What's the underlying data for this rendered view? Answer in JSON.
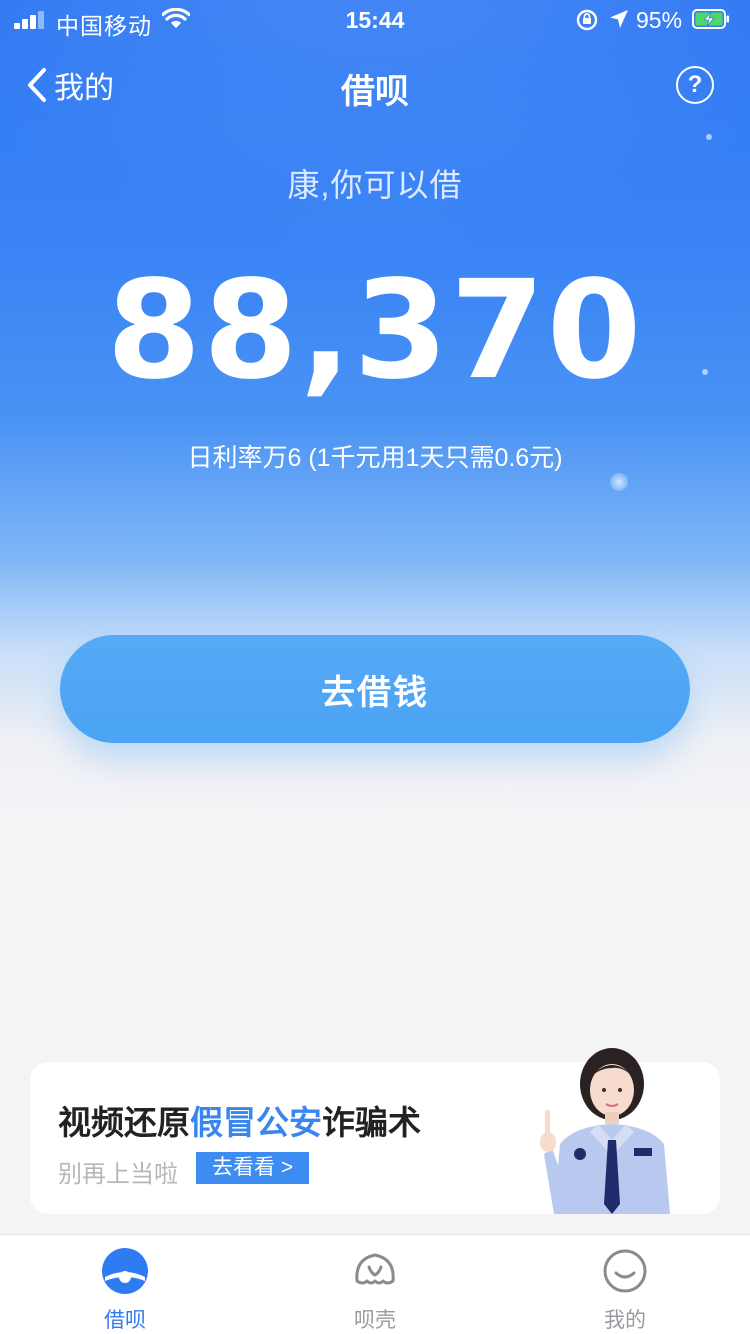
{
  "status_bar": {
    "carrier": "中国移动",
    "time": "15:44",
    "battery_percent": "95%"
  },
  "nav": {
    "back_label": "我的",
    "title": "借呗",
    "help_glyph": "?"
  },
  "hero": {
    "greeting": "康,你可以借",
    "amount": "88,370",
    "rate_text": "日利率万6 (1千元用1天只需0.6元)"
  },
  "borrow_button": {
    "label": "去借钱"
  },
  "banner": {
    "title_part1": "视频还原",
    "title_highlight": "假冒公安",
    "title_part2": "诈骗术",
    "subtitle": "别再上当啦",
    "cta": "去看看 >"
  },
  "tabbar": {
    "tabs": [
      {
        "label": "借呗",
        "icon": "jiebei-icon",
        "active": true
      },
      {
        "label": "呗壳",
        "icon": "shell-icon",
        "active": false
      },
      {
        "label": "我的",
        "icon": "smile-icon",
        "active": false
      }
    ]
  },
  "colors": {
    "primary_blue": "#2f78f2",
    "button_blue": "#4aa3f4",
    "highlight_blue": "#3a86f0",
    "page_bg": "#f4f4f6"
  }
}
